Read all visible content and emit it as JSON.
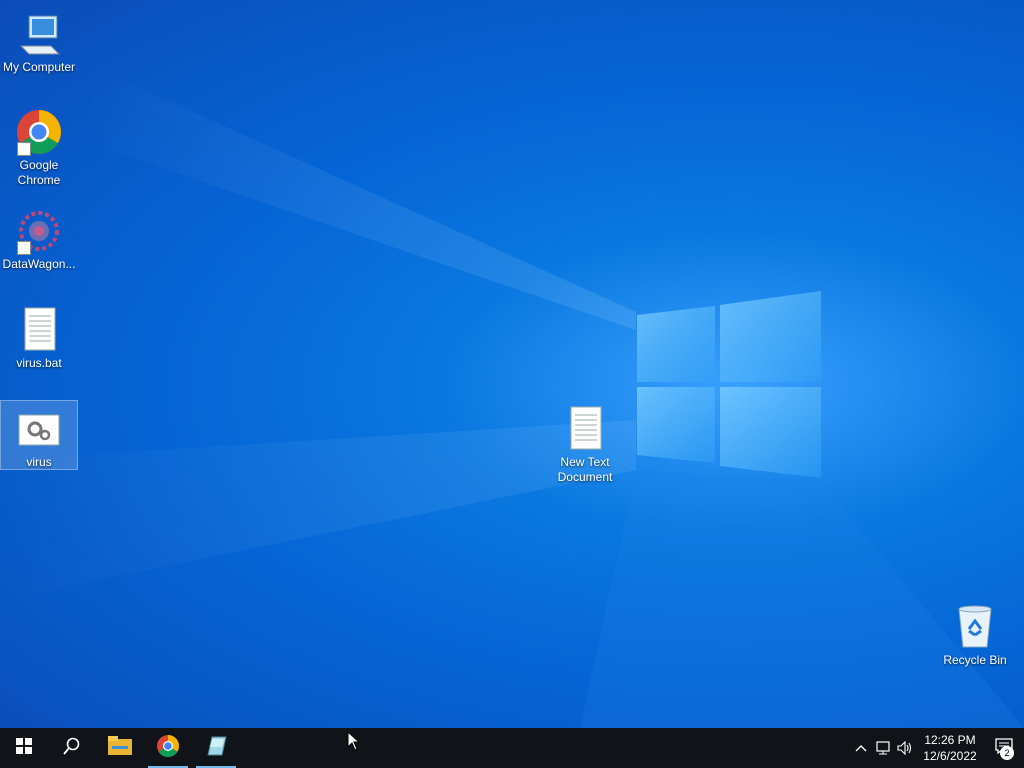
{
  "desktop": {
    "icons": [
      {
        "label": "My Computer"
      },
      {
        "label": "Google\nChrome"
      },
      {
        "label": "DataWagon..."
      },
      {
        "label": "virus.bat"
      },
      {
        "label": "virus"
      },
      {
        "label": "New Text\nDocument"
      },
      {
        "label": "Recycle Bin"
      }
    ]
  },
  "taskbar": {
    "buttons": [
      {
        "icon": "windows-start-icon"
      },
      {
        "icon": "search-icon"
      },
      {
        "icon": "file-explorer-icon"
      },
      {
        "icon": "chrome-icon"
      },
      {
        "icon": "app-icon"
      }
    ],
    "tray": {
      "time": "12:26 PM",
      "date": "12/6/2022",
      "notification_count": "2"
    }
  },
  "colors": {
    "taskbar": "#101418",
    "accent": "#76b9ed",
    "desktop": "#0565d6"
  }
}
